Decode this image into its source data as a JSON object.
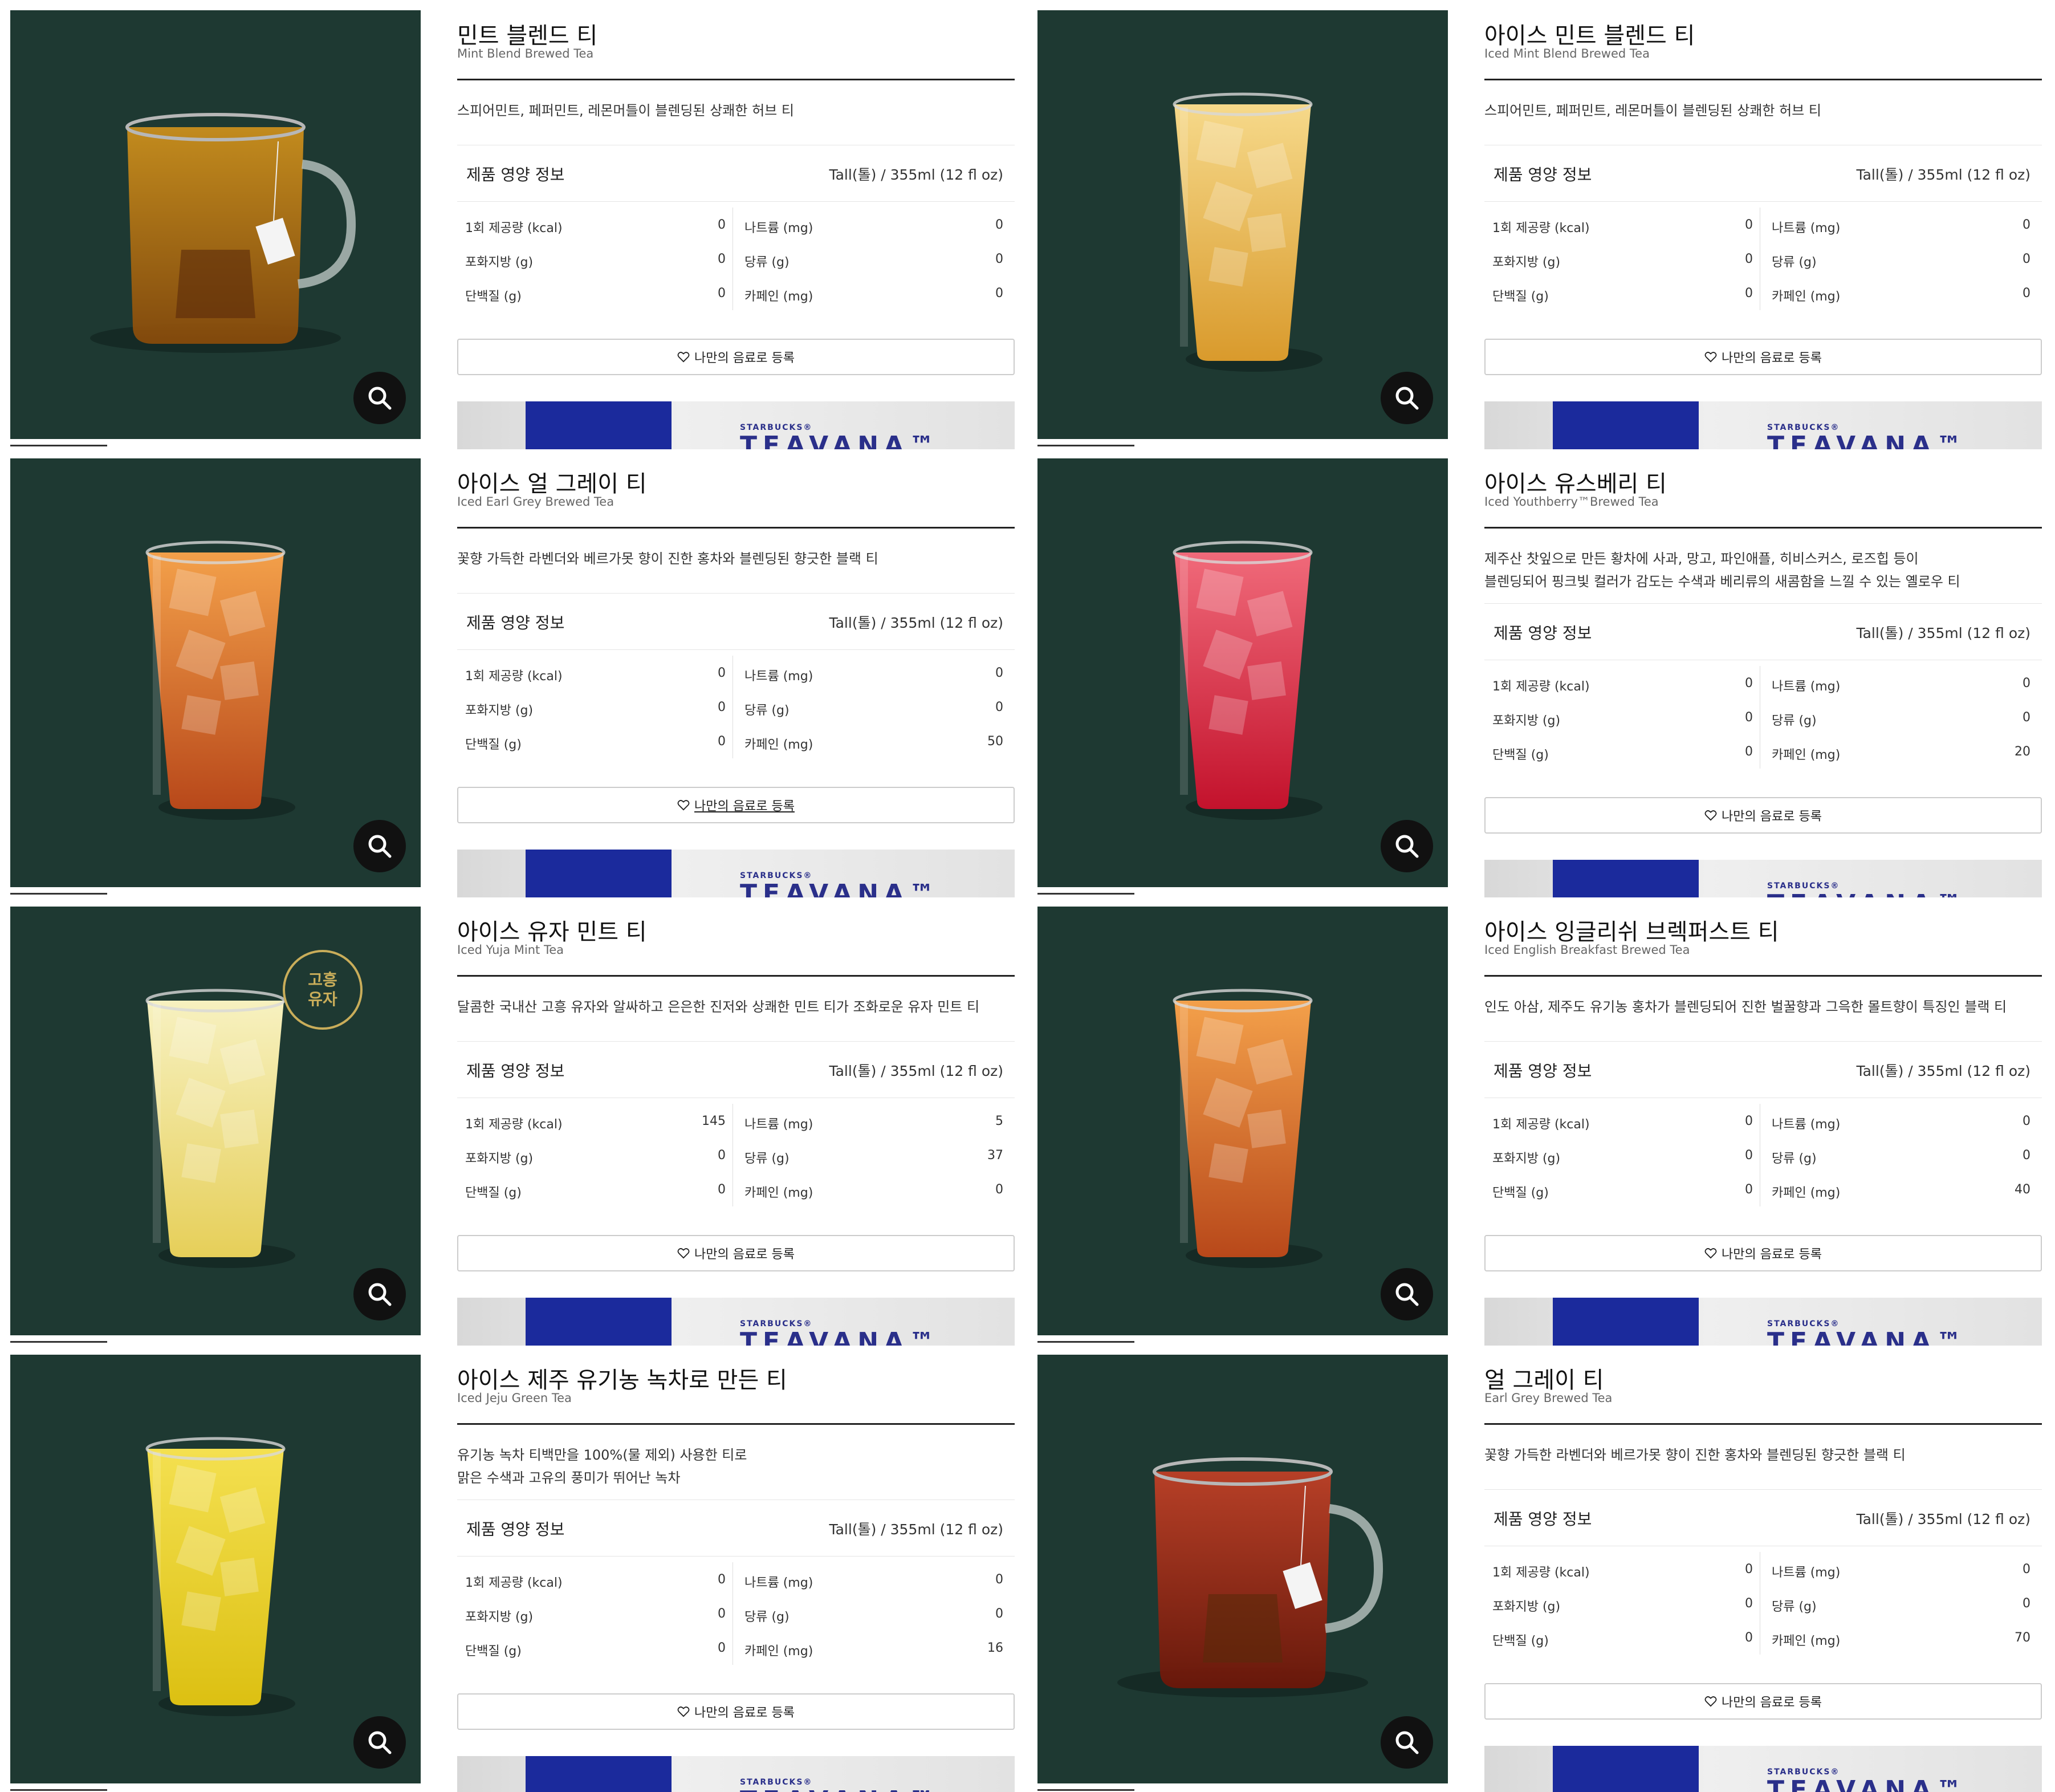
{
  "ui": {
    "nutrition_heading": "제품 영양 정보",
    "serving_size": "Tall(톨) / 355ml (12 fl oz)",
    "favorite_label": "나만의 음료로 등록",
    "banner_brand": "STARBUCKS®",
    "banner_logo": "TEAVANA™",
    "nutrient_labels": {
      "kcal": "1회 제공량 (kcal)",
      "sat_fat": "포화지방 (g)",
      "protein": "단백질 (g)",
      "sodium": "나트륨 (mg)",
      "sugar": "당류 (g)",
      "caffeine": "카페인 (mg)"
    }
  },
  "colors": {
    "photo_bg": "#1e3932",
    "badge_gold": "#c9ad5a",
    "banner_blue": "#1b2a9c"
  },
  "products": [
    {
      "name_ko": "민트 블렌드 티",
      "name_en": "Mint Blend Brewed Tea",
      "description": "스피어민트, 페퍼민트, 레몬머틀이 블렌딩된 상쾌한 허브 티",
      "drink": "hot-mug-amber",
      "nutrition": {
        "kcal": "0",
        "sat_fat": "0",
        "protein": "0",
        "sodium": "0",
        "sugar": "0",
        "caffeine": "0"
      }
    },
    {
      "name_ko": "아이스 민트 블렌드 티",
      "name_en": "Iced Mint Blend Brewed Tea",
      "description": "스피어민트, 페퍼민트, 레몬머틀이 블렌딩된 상쾌한 허브 티",
      "drink": "iced-glass-pale-gold",
      "nutrition": {
        "kcal": "0",
        "sat_fat": "0",
        "protein": "0",
        "sodium": "0",
        "sugar": "0",
        "caffeine": "0"
      }
    },
    {
      "name_ko": "아이스 얼 그레이 티",
      "name_en": "Iced Earl Grey Brewed Tea",
      "description": "꽃향 가득한 라벤더와 베르가못 향이 진한 홍차와 블렌딩된 향긋한 블랙 티",
      "drink": "iced-glass-orange",
      "nutrition": {
        "kcal": "0",
        "sat_fat": "0",
        "protein": "0",
        "sodium": "0",
        "sugar": "0",
        "caffeine": "50"
      }
    },
    {
      "name_ko": "아이스 유스베리 티",
      "name_en": "Iced Youthberry™Brewed Tea",
      "description": "제주산 찻잎으로 만든 황차에 사과, 망고, 파인애플, 히비스커스, 로즈힙 등이\n블렌딩되어 핑크빛 컬러가 감도는 수색과 베리류의 새콤함을 느낄 수 있는 옐로우 티",
      "drink": "iced-glass-red",
      "nutrition": {
        "kcal": "0",
        "sat_fat": "0",
        "protein": "0",
        "sodium": "0",
        "sugar": "0",
        "caffeine": "20"
      }
    },
    {
      "name_ko": "아이스 유자 민트 티",
      "name_en": "Iced Yuja Mint Tea",
      "description": "달콤한 국내산 고흥 유자와 알싸하고 은은한 진저와 상쾌한 민트 티가 조화로운 유자 민트 티",
      "drink": "iced-glass-pale-yellow",
      "badge": "고흥\n유자",
      "nutrition": {
        "kcal": "145",
        "sat_fat": "0",
        "protein": "0",
        "sodium": "5",
        "sugar": "37",
        "caffeine": "0"
      }
    },
    {
      "name_ko": "아이스 잉글리쉬 브렉퍼스트 티",
      "name_en": "Iced English Breakfast Brewed Tea",
      "description": "인도 아삼, 제주도 유기농 홍차가 블렌딩되어 진한 벌꿀향과 그윽한 몰트향이 특징인 블랙 티",
      "drink": "iced-glass-orange",
      "nutrition": {
        "kcal": "0",
        "sat_fat": "0",
        "protein": "0",
        "sodium": "0",
        "sugar": "0",
        "caffeine": "40"
      }
    },
    {
      "name_ko": "아이스 제주 유기농 녹차로 만든 티",
      "name_en": "Iced Jeju Green Tea",
      "description": "유기농 녹차 티백만을 100%(물 제외) 사용한 티로\n맑은 수색과 고유의 풍미가 뛰어난 녹차",
      "drink": "iced-glass-yellow",
      "nutrition": {
        "kcal": "0",
        "sat_fat": "0",
        "protein": "0",
        "sodium": "0",
        "sugar": "0",
        "caffeine": "16"
      }
    },
    {
      "name_ko": "얼 그레이 티",
      "name_en": "Earl Grey Brewed Tea",
      "description": "꽃향 가득한 라벤더와 베르가못 향이 진한 홍차와 블렌딩된 향긋한 블랙 티",
      "drink": "hot-mug-red",
      "nutrition": {
        "kcal": "0",
        "sat_fat": "0",
        "protein": "0",
        "sodium": "0",
        "sugar": "0",
        "caffeine": "70"
      }
    }
  ]
}
